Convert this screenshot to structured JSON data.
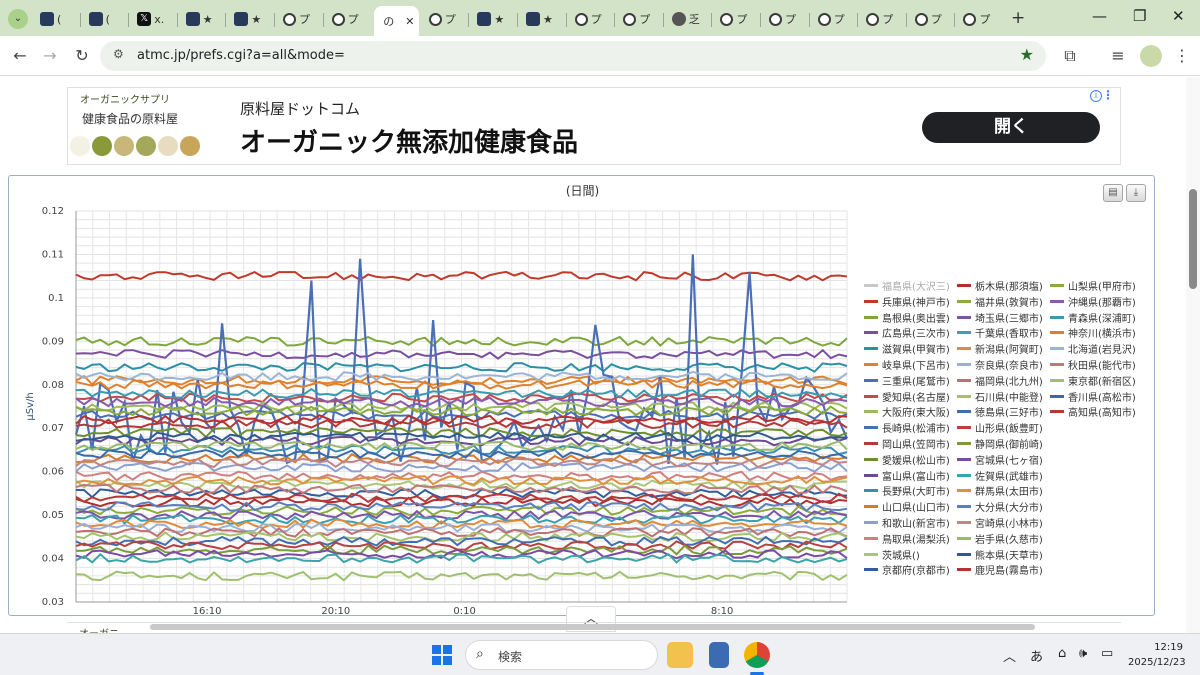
{
  "browser": {
    "tabs": [
      {
        "icon": "document-favicon-icon",
        "text": "("
      },
      {
        "icon": "document-favicon-icon",
        "text": "("
      },
      {
        "icon": "x-favicon-icon",
        "text": "x."
      },
      {
        "icon": "document-favicon-icon",
        "text": "★"
      },
      {
        "icon": "document-favicon-icon",
        "text": "★"
      },
      {
        "icon": "circle-favicon-icon",
        "text": "プ"
      },
      {
        "icon": "circle-favicon-icon",
        "text": "プ"
      },
      {
        "icon": "page-favicon-icon",
        "text": "の"
      },
      {
        "icon": "circle-favicon-icon",
        "text": "プ"
      },
      {
        "icon": "document-favicon-icon",
        "text": "★"
      },
      {
        "icon": "document-favicon-icon",
        "text": "★"
      },
      {
        "icon": "circle-favicon-icon",
        "text": "プ"
      },
      {
        "icon": "circle-favicon-icon",
        "text": "プ"
      },
      {
        "icon": "globe-favicon-icon",
        "text": "乏"
      },
      {
        "icon": "circle-favicon-icon",
        "text": "プ"
      },
      {
        "icon": "circle-favicon-icon",
        "text": "プ"
      },
      {
        "icon": "circle-favicon-icon",
        "text": "プ"
      },
      {
        "icon": "circle-favicon-icon",
        "text": "プ"
      },
      {
        "icon": "circle-favicon-icon",
        "text": "プ"
      },
      {
        "icon": "circle-favicon-icon",
        "text": "プ"
      }
    ],
    "active_tab_close": "✕",
    "new_tab": "+",
    "url": "atmc.jp/prefs.cgi?a=all&mode="
  },
  "ad": {
    "brand": "オーガニックサプリ",
    "subtitle": "健康食品の原料屋",
    "company": "原料屋ドットコム",
    "headline": "オーガニック無添加健康食品",
    "open_button": "開く",
    "info": "i",
    "more": "⋮"
  },
  "ad2": {
    "brand": "オーガニ"
  },
  "chart_data": {
    "type": "line",
    "title": "(日間)",
    "ylabel": "μSv/h",
    "xlabel": "",
    "ylim": [
      0.03,
      0.12
    ],
    "yticks": [
      "0.12",
      "0.11",
      "0.1",
      "0.09",
      "0.08",
      "0.07",
      "0.06",
      "0.05",
      "0.04",
      "0.03"
    ],
    "xticks": [
      "16:10",
      "20:10",
      "0:10",
      "8:10"
    ],
    "legend_position": "right",
    "series": [
      {
        "name": "福島県(大沢三)",
        "color": "#c8c8c8",
        "level": null
      },
      {
        "name": "兵庫県(神戸市)",
        "color": "#c0392b",
        "level": 0.105
      },
      {
        "name": "島根県(奥出雲)",
        "color": "#7ea83a",
        "level": 0.09
      },
      {
        "name": "広島県(三次市)",
        "color": "#7b4fa0",
        "level": 0.087
      },
      {
        "name": "滋賀県(甲賀市)",
        "color": "#2c8fa3",
        "level": 0.084
      },
      {
        "name": "岐阜県(下呂市)",
        "color": "#e0812c",
        "level": 0.081
      },
      {
        "name": "三重県(尾鷲市)",
        "color": "#4a6fb5",
        "level": 0.079
      },
      {
        "name": "愛知県(名古屋)",
        "color": "#c24a48",
        "level": 0.077
      },
      {
        "name": "大阪府(東大阪)",
        "color": "#9bbb59",
        "level": 0.075
      },
      {
        "name": "長崎県(松浦市)",
        "color": "#4a6fb5",
        "level": 0.073
      },
      {
        "name": "岡山県(笠岡市)",
        "color": "#b03a3a",
        "level": 0.071
      },
      {
        "name": "愛媛県(松山市)",
        "color": "#6f8f2f",
        "level": 0.069
      },
      {
        "name": "富山県(富山市)",
        "color": "#6a4a90",
        "level": 0.067
      },
      {
        "name": "長野県(大町市)",
        "color": "#3a8fb0",
        "level": 0.065
      },
      {
        "name": "山口県(山口市)",
        "color": "#d97a2a",
        "level": 0.063
      },
      {
        "name": "和歌山(新宮市)",
        "color": "#8aa0d0",
        "level": 0.061
      },
      {
        "name": "鳥取県(湯梨浜)",
        "color": "#d08080",
        "level": 0.059
      },
      {
        "name": "茨城県()",
        "color": "#a8c878",
        "level": 0.057
      },
      {
        "name": "京都府(京都市)",
        "color": "#2f5f9f",
        "level": 0.055
      },
      {
        "name": "栃木県(那須塩)",
        "color": "#b03030",
        "level": 0.053
      },
      {
        "name": "福井県(敦賀市)",
        "color": "#8aac3a",
        "level": 0.051
      },
      {
        "name": "埼玉県(三郷市)",
        "color": "#7a55a5",
        "level": 0.05
      },
      {
        "name": "千葉県(香取市)",
        "color": "#3aa0b0",
        "level": 0.049
      },
      {
        "name": "新潟県(阿賀町)",
        "color": "#e08a3a",
        "level": 0.048
      },
      {
        "name": "奈良県(奈良市)",
        "color": "#9ab0d8",
        "level": 0.047
      },
      {
        "name": "福岡県(北九州)",
        "color": "#c07070",
        "level": 0.046
      },
      {
        "name": "石川県(中能登)",
        "color": "#a5c26a",
        "level": 0.045
      },
      {
        "name": "徳島県(三好市)",
        "color": "#3f6fb0",
        "level": 0.044
      },
      {
        "name": "山形県(飯豊町)",
        "color": "#b84040",
        "level": 0.043
      },
      {
        "name": "静岡県(御前崎)",
        "color": "#7a9a3a",
        "level": 0.042
      },
      {
        "name": "宮城県(七ヶ宿)",
        "color": "#7a4aa5",
        "level": 0.041
      },
      {
        "name": "佐賀県(武雄市)",
        "color": "#3aa5a5",
        "level": 0.04
      },
      {
        "name": "群馬県(太田市)",
        "color": "#e0903a",
        "level": 0.058
      },
      {
        "name": "大分県(大分市)",
        "color": "#5a7fc0",
        "level": 0.052
      },
      {
        "name": "宮崎県(小林市)",
        "color": "#c08585",
        "level": 0.062
      },
      {
        "name": "岩手県(久慈市)",
        "color": "#9aba6a",
        "level": 0.066
      },
      {
        "name": "熊本県(天草市)",
        "color": "#2f5a90",
        "level": 0.068
      },
      {
        "name": "鹿児島(霧島市)",
        "color": "#b83030",
        "level": 0.072
      },
      {
        "name": "山梨県(甲府市)",
        "color": "#8aaa3a",
        "level": 0.074
      },
      {
        "name": "沖縄県(那覇市)",
        "color": "#8a5ab0",
        "level": 0.076
      },
      {
        "name": "青森県(深浦町)",
        "color": "#3a9ab0",
        "level": 0.078
      },
      {
        "name": "神奈川(横浜市)",
        "color": "#e0802a",
        "level": 0.08
      },
      {
        "name": "北海道(岩見沢)",
        "color": "#9ab5d8",
        "level": 0.082
      },
      {
        "name": "秋田県(能代市)",
        "color": "#c07878",
        "level": 0.056
      },
      {
        "name": "東京都(新宿区)",
        "color": "#a0c070",
        "level": 0.036
      },
      {
        "name": "香川県(高松市)",
        "color": "#3a6aa8",
        "level": 0.064
      },
      {
        "name": "高知県(高知市)",
        "color": "#b83838",
        "level": 0.054
      }
    ]
  },
  "taskbar": {
    "search_label": "検索",
    "ime": "あ",
    "time": "12:19",
    "date": "2025/12/23"
  }
}
